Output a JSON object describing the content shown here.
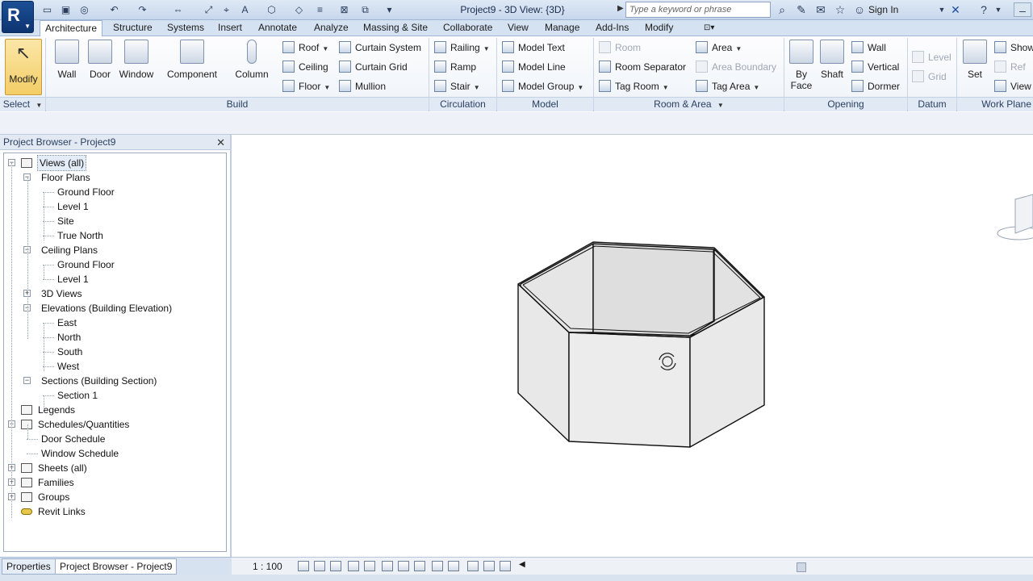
{
  "titlebar": {
    "title": "Project9 - 3D View: {3D}",
    "search_placeholder": "Type a keyword or phrase",
    "sign_in": "Sign In"
  },
  "tabs": [
    "Architecture",
    "Structure",
    "Systems",
    "Insert",
    "Annotate",
    "Analyze",
    "Massing & Site",
    "Collaborate",
    "View",
    "Manage",
    "Add-Ins",
    "Modify"
  ],
  "ribbon": {
    "modify": "Modify",
    "select": "Select",
    "build": {
      "title": "Build",
      "wall": "Wall",
      "door": "Door",
      "window": "Window",
      "component": "Component",
      "column": "Column",
      "roof": "Roof",
      "ceiling": "Ceiling",
      "floor": "Floor",
      "curtain_system": "Curtain System",
      "curtain_grid": "Curtain Grid",
      "mullion": "Mullion"
    },
    "circulation": {
      "title": "Circulation",
      "railing": "Railing",
      "ramp": "Ramp",
      "stair": "Stair"
    },
    "model": {
      "title": "Model",
      "model_text": "Model Text",
      "model_line": "Model Line",
      "model_group": "Model Group"
    },
    "room_area": {
      "title": "Room & Area",
      "room": "Room",
      "room_separator": "Room Separator",
      "tag_room": "Tag Room",
      "area": "Area",
      "area_boundary": "Area Boundary",
      "tag_area": "Tag Area"
    },
    "opening": {
      "title": "Opening",
      "by_face": "By",
      "by_face2": "Face",
      "shaft": "Shaft",
      "wall": "Wall",
      "vertical": "Vertical",
      "dormer": "Dormer"
    },
    "datum": {
      "title": "Datum",
      "level": "Level",
      "grid": "Grid"
    },
    "work_plane": {
      "title": "Work Plane",
      "set": "Set",
      "show": "Show",
      "ref": "Ref",
      "view": "View"
    }
  },
  "project_browser": {
    "title": "Project Browser - Project9",
    "tree": [
      {
        "label": "Views (all)",
        "level": 0
      },
      {
        "label": "Floor Plans",
        "level": 1
      },
      {
        "label": "Ground Floor",
        "level": 2
      },
      {
        "label": "Level 1",
        "level": 2
      },
      {
        "label": "Site",
        "level": 2
      },
      {
        "label": "True North",
        "level": 2
      },
      {
        "label": "Ceiling Plans",
        "level": 1
      },
      {
        "label": "Ground Floor",
        "level": 2
      },
      {
        "label": "Level 1",
        "level": 2
      },
      {
        "label": "3D Views",
        "level": 1
      },
      {
        "label": "Elevations (Building Elevation)",
        "level": 1
      },
      {
        "label": "East",
        "level": 2
      },
      {
        "label": "North",
        "level": 2
      },
      {
        "label": "South",
        "level": 2
      },
      {
        "label": "West",
        "level": 2
      },
      {
        "label": "Sections (Building Section)",
        "level": 1
      },
      {
        "label": "Section 1",
        "level": 2
      },
      {
        "label": "Legends",
        "level": 0
      },
      {
        "label": "Schedules/Quantities",
        "level": 0
      },
      {
        "label": "Door Schedule",
        "level": 1
      },
      {
        "label": "Window Schedule",
        "level": 1
      },
      {
        "label": "Sheets (all)",
        "level": 0
      },
      {
        "label": "Families",
        "level": 0
      },
      {
        "label": "Groups",
        "level": 0
      },
      {
        "label": "Revit Links",
        "level": 0
      }
    ]
  },
  "bottom_tabs": {
    "properties": "Properties",
    "project_browser": "Project Browser - Project9"
  },
  "viewbar": {
    "scale": "1 : 100"
  }
}
